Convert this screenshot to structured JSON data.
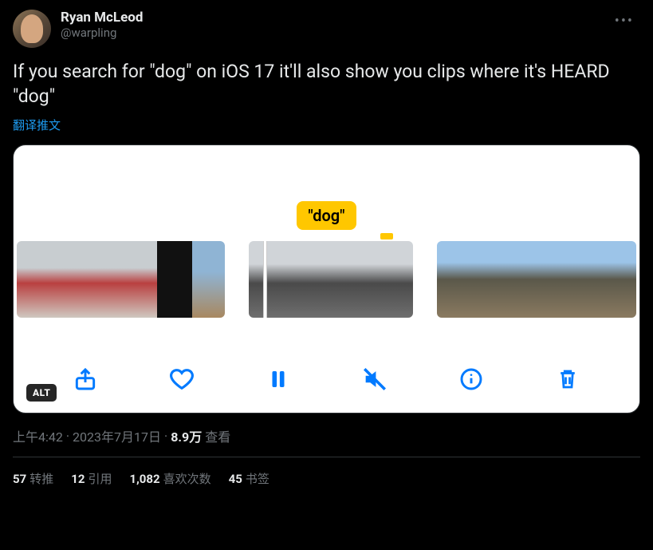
{
  "user": {
    "display_name": "Ryan McLeod",
    "handle": "@warpling"
  },
  "tweet_text": "If you search for \"dog\" on iOS 17 it'll also show you clips where it's HEARD \"dog\"",
  "translate_label": "翻译推文",
  "media": {
    "chip_text": "\"dog\"",
    "alt_badge": "ALT"
  },
  "meta": {
    "time": "上午4:42",
    "dot1": " · ",
    "date": "2023年7月17日",
    "dot2": " · ",
    "views_count": "8.9万",
    "views_label": " 查看"
  },
  "stats": {
    "retweets_count": "57",
    "retweets_label": "转推",
    "quotes_count": "12",
    "quotes_label": "引用",
    "likes_count": "1,082",
    "likes_label": "喜欢次数",
    "bookmarks_count": "45",
    "bookmarks_label": "书签"
  }
}
